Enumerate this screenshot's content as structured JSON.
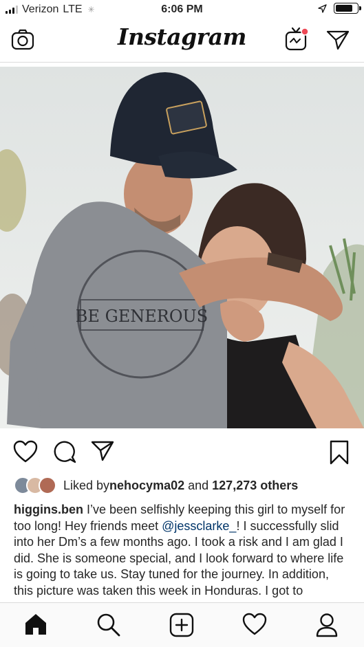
{
  "status_bar": {
    "carrier": "Verizon",
    "network": "LTE",
    "time": "6:06 PM",
    "signal_bars_filled": 3,
    "signal_bars_total": 4,
    "battery_level": 0.85,
    "icons": [
      "signal-icon",
      "loading-icon",
      "location-arrow-icon",
      "battery-icon"
    ]
  },
  "header": {
    "logo": "Instagram",
    "icons": [
      "camera-icon",
      "igtv-icon",
      "direct-message-icon"
    ],
    "igtv_notification": true
  },
  "post": {
    "image_shirt_text": "BE GENEROUS",
    "actions": [
      "heart-icon",
      "comment-icon",
      "share-icon",
      "bookmark-icon"
    ],
    "likes": {
      "prefix": "Liked by ",
      "user": "nehocyma02",
      "connector": " and ",
      "others": "127,273 others"
    },
    "caption": {
      "username": "higgins.ben",
      "text_before_mention": "I’ve been selfishly keeping this girl to myself for too long! Hey friends meet ",
      "mention": "@jessclarke_",
      "text_after_mention": "! I successfully slid into her Dm’s a few months ago. I took a risk and I am glad I did. She is someone special, and I look forward to where life is going to take us. Stay tuned for the journey. In addition, this picture was taken this week in Honduras. I got to"
    }
  },
  "tab_bar": {
    "icons": [
      "home-icon",
      "search-icon",
      "new-post-icon",
      "activity-icon",
      "profile-icon"
    ],
    "active": "home-icon"
  },
  "colors": {
    "text": "#262626",
    "mention": "#003569",
    "divider": "#dbdbdb",
    "notification_dot": "#ed4956"
  }
}
